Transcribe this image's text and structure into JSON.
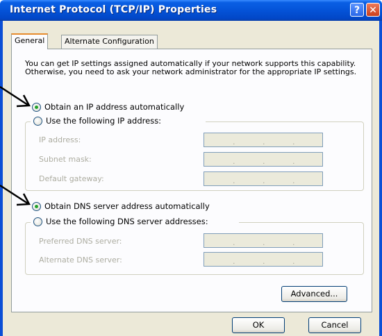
{
  "window": {
    "title": "Internet Protocol (TCP/IP) Properties",
    "help_label": "?",
    "close_label": "✕"
  },
  "tabs": [
    {
      "label": "General",
      "active": true
    },
    {
      "label": "Alternate Configuration",
      "active": false
    }
  ],
  "description": "You can get IP settings assigned automatically if your network supports this capability. Otherwise, you need to ask your network administrator for the appropriate IP settings.",
  "ip": {
    "auto_label": "Obtain an IP address automatically",
    "auto_checked": true,
    "manual_label": "Use the following IP address:",
    "fields": [
      {
        "label": "IP address:"
      },
      {
        "label": "Subnet mask:"
      },
      {
        "label": "Default gateway:"
      }
    ]
  },
  "dns": {
    "auto_label": "Obtain DNS server address automatically",
    "auto_checked": true,
    "manual_label": "Use the following DNS server addresses:",
    "fields": [
      {
        "label": "Preferred DNS server:"
      },
      {
        "label": "Alternate DNS server:"
      }
    ]
  },
  "buttons": {
    "advanced": "Advanced...",
    "ok": "OK",
    "cancel": "Cancel"
  },
  "colors": {
    "titlebar": "#0453d8",
    "dialog_bg": "#ece9d8",
    "active_tab_accent": "#e68b2c",
    "radio_dot": "#24a22a"
  },
  "icons": [
    "help-icon",
    "close-icon",
    "annotation-arrow"
  ]
}
